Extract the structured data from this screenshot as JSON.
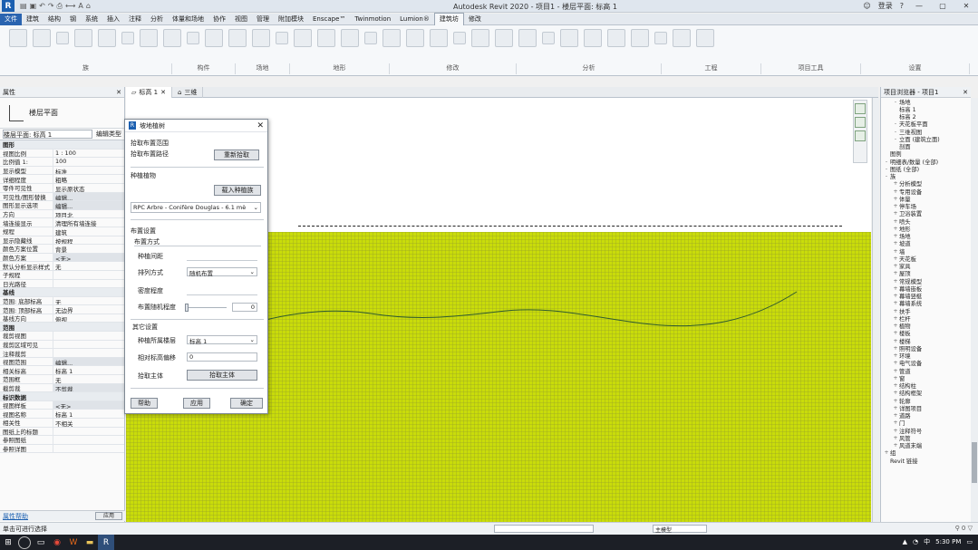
{
  "titlebar": {
    "logo": "R",
    "title": "Autodesk Revit 2020 - 项目1 - 楼层平面: 标高 1",
    "user": "登录",
    "minimize": "—",
    "restore": "▢",
    "close": "✕"
  },
  "ribbon_tabs": [
    "文件",
    "建筑",
    "结构",
    "钢",
    "系统",
    "插入",
    "注释",
    "分析",
    "体量和场地",
    "协作",
    "视图",
    "管理",
    "附加模块",
    "Enscape™",
    "Twinmotion",
    "Lumion®",
    "建筑坊",
    "修改"
  ],
  "ribbon_panels": [
    "族",
    "构件",
    "场地",
    "地形",
    "修改",
    "分析",
    "工程",
    "项目工具",
    "设置"
  ],
  "properties": {
    "title": "属性",
    "type_name": "楼层平面",
    "selector": "楼层平面: 标高 1",
    "edit_type": "编辑类型",
    "rows": [
      {
        "k": "图形",
        "v": "",
        "group": true
      },
      {
        "k": "视图比例",
        "v": "1 : 100"
      },
      {
        "k": "比例值 1:",
        "v": "100"
      },
      {
        "k": "显示模型",
        "v": "标准"
      },
      {
        "k": "详细程度",
        "v": "粗略"
      },
      {
        "k": "零件可见性",
        "v": "显示原状态"
      },
      {
        "k": "可见性/图形替换",
        "v": "编辑...",
        "btn": true
      },
      {
        "k": "图形显示选项",
        "v": "编辑...",
        "btn": true
      },
      {
        "k": "方向",
        "v": "项目北"
      },
      {
        "k": "墙连接显示",
        "v": "清理所有墙连接"
      },
      {
        "k": "规程",
        "v": "建筑"
      },
      {
        "k": "显示隐藏线",
        "v": "按规程"
      },
      {
        "k": "颜色方案位置",
        "v": "背景"
      },
      {
        "k": "颜色方案",
        "v": "<无>",
        "btn": true
      },
      {
        "k": "默认分析显示样式",
        "v": "无"
      },
      {
        "k": "子规程",
        "v": ""
      },
      {
        "k": "日光路径",
        "v": ""
      },
      {
        "k": "基线",
        "v": "",
        "group": true
      },
      {
        "k": "范围: 底部标高",
        "v": "无"
      },
      {
        "k": "范围: 顶部标高",
        "v": "无边界"
      },
      {
        "k": "基线方向",
        "v": "俯视"
      },
      {
        "k": "范围",
        "v": "",
        "group": true
      },
      {
        "k": "裁剪视图",
        "v": ""
      },
      {
        "k": "裁剪区域可见",
        "v": ""
      },
      {
        "k": "注释裁剪",
        "v": ""
      },
      {
        "k": "视图范围",
        "v": "编辑...",
        "btn": true
      },
      {
        "k": "相关标高",
        "v": "标高 1"
      },
      {
        "k": "范围框",
        "v": "无"
      },
      {
        "k": "截剪裁",
        "v": "不剪裁",
        "btn": true
      },
      {
        "k": "标识数据",
        "v": "",
        "group": true
      },
      {
        "k": "视图样板",
        "v": "<无>",
        "btn": true
      },
      {
        "k": "视图名称",
        "v": "标高 1"
      },
      {
        "k": "相关性",
        "v": "不相关"
      },
      {
        "k": "图纸上的标题",
        "v": ""
      },
      {
        "k": "参照图纸",
        "v": ""
      },
      {
        "k": "参照详图",
        "v": ""
      }
    ],
    "help_link": "属性帮助",
    "apply": "应用"
  },
  "view_tabs": [
    {
      "label": "标高 1",
      "active": true
    },
    {
      "label": "三维",
      "active": false
    }
  ],
  "dialog": {
    "title": "坡地植树",
    "section1_line1": "拾取布置范围",
    "section1_line2": "拾取布置路径",
    "pick_button": "重新拾取",
    "plant_label": "种植植物",
    "load_family_button": "载入种植族",
    "plant_value": "RPC Arbre - Conifère Douglas - 6.1 mè",
    "layout_label": "布置设置",
    "mode_label": "布置方式",
    "spacing_label": "种植间距",
    "arrange_label": "排列方式",
    "arrange_value": "随机布置",
    "density_label": "密度程度",
    "random_label": "布置随机程度",
    "random_value": "0",
    "other_label": "其它设置",
    "level_label": "种植所属楼层",
    "level_value": "标高 1",
    "offset_label": "相对标高偏移",
    "offset_value": "0",
    "host_label": "拾取主体",
    "host_button": "拾取主体",
    "help_button": "帮助",
    "apply_button": "应用",
    "ok_button": "确定"
  },
  "browser": {
    "title": "项目浏览器 - 项目1",
    "items": [
      {
        "t": "场地",
        "i": 1,
        "e": "-"
      },
      {
        "t": "标高 1",
        "i": 1,
        "e": ""
      },
      {
        "t": "标高 2",
        "i": 1,
        "e": ""
      },
      {
        "t": "天花板平面",
        "i": 1,
        "e": "-"
      },
      {
        "t": "三维视图",
        "i": 1,
        "e": "-"
      },
      {
        "t": "立面 (建筑立面)",
        "i": 1,
        "e": "-"
      },
      {
        "t": "剖面",
        "i": 1,
        "e": ""
      },
      {
        "t": "图例",
        "i": 0,
        "e": ""
      },
      {
        "t": "明细表/数量 (全部)",
        "i": 0,
        "e": "-"
      },
      {
        "t": "图纸 (全部)",
        "i": 0,
        "e": "-"
      },
      {
        "t": "族",
        "i": 0,
        "e": "-"
      },
      {
        "t": "分析模型",
        "i": 1,
        "e": "+"
      },
      {
        "t": "专用设备",
        "i": 1,
        "e": "+"
      },
      {
        "t": "体量",
        "i": 1,
        "e": "+"
      },
      {
        "t": "停车场",
        "i": 1,
        "e": "+"
      },
      {
        "t": "卫浴装置",
        "i": 1,
        "e": "+"
      },
      {
        "t": "喷头",
        "i": 1,
        "e": "+"
      },
      {
        "t": "地形",
        "i": 1,
        "e": "+"
      },
      {
        "t": "场地",
        "i": 1,
        "e": "+"
      },
      {
        "t": "坡道",
        "i": 1,
        "e": "+"
      },
      {
        "t": "墙",
        "i": 1,
        "e": "+"
      },
      {
        "t": "天花板",
        "i": 1,
        "e": "+"
      },
      {
        "t": "家具",
        "i": 1,
        "e": "+"
      },
      {
        "t": "屋顶",
        "i": 1,
        "e": "+"
      },
      {
        "t": "常规模型",
        "i": 1,
        "e": "+"
      },
      {
        "t": "幕墙嵌板",
        "i": 1,
        "e": "+"
      },
      {
        "t": "幕墙竖梃",
        "i": 1,
        "e": "+"
      },
      {
        "t": "幕墙系统",
        "i": 1,
        "e": "+"
      },
      {
        "t": "扶手",
        "i": 1,
        "e": "+"
      },
      {
        "t": "栏杆",
        "i": 1,
        "e": "+"
      },
      {
        "t": "植物",
        "i": 1,
        "e": "+"
      },
      {
        "t": "楼板",
        "i": 1,
        "e": "+"
      },
      {
        "t": "楼梯",
        "i": 1,
        "e": "+"
      },
      {
        "t": "照明设备",
        "i": 1,
        "e": "+"
      },
      {
        "t": "环境",
        "i": 1,
        "e": "+"
      },
      {
        "t": "电气设备",
        "i": 1,
        "e": "+"
      },
      {
        "t": "管道",
        "i": 1,
        "e": "+"
      },
      {
        "t": "窗",
        "i": 1,
        "e": "+"
      },
      {
        "t": "结构柱",
        "i": 1,
        "e": "+"
      },
      {
        "t": "结构框架",
        "i": 1,
        "e": "+"
      },
      {
        "t": "轮廓",
        "i": 1,
        "e": "+"
      },
      {
        "t": "详图项目",
        "i": 1,
        "e": "+"
      },
      {
        "t": "道路",
        "i": 1,
        "e": "+"
      },
      {
        "t": "门",
        "i": 1,
        "e": "+"
      },
      {
        "t": "注释符号",
        "i": 1,
        "e": "+"
      },
      {
        "t": "风管",
        "i": 1,
        "e": "+"
      },
      {
        "t": "风道末端",
        "i": 1,
        "e": "+"
      },
      {
        "t": "组",
        "i": 0,
        "e": "+"
      },
      {
        "t": "Revit 链接",
        "i": 0,
        "e": ""
      }
    ]
  },
  "status": {
    "left": "单击可进行选择",
    "mid": "主模型",
    "right": "⚲ 0 ▽"
  },
  "taskbar": {
    "start": "⊞",
    "tray_lang": "中",
    "tray_time": "5:30 PM"
  }
}
